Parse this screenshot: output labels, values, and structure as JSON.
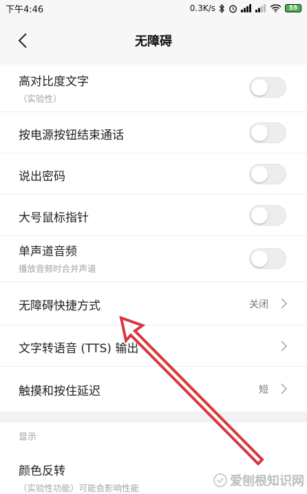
{
  "status_bar": {
    "time": "下午4:46",
    "net_speed": "0.3K/s",
    "battery": "55"
  },
  "header": {
    "title": "无障碍"
  },
  "settings": [
    {
      "title": "高对比度文字",
      "subtitle": "（实验性）",
      "control": "toggle",
      "on": false
    },
    {
      "title": "按电源按钮结束通话",
      "control": "toggle",
      "on": false
    },
    {
      "title": "说出密码",
      "control": "toggle",
      "on": false
    },
    {
      "title": "大号鼠标指针",
      "control": "toggle",
      "on": false
    },
    {
      "title": "单声道音频",
      "subtitle": "播放音频时合并声道",
      "control": "toggle",
      "on": false
    },
    {
      "title": "无障碍快捷方式",
      "value": "关闭",
      "control": "chevron"
    },
    {
      "title": "文字转语音 (TTS) 输出",
      "control": "chevron"
    },
    {
      "title": "触摸和按住延迟",
      "value": "短",
      "control": "chevron"
    }
  ],
  "display_section": {
    "header": "显示",
    "item": {
      "title": "颜色反转",
      "subtitle": "（实验性功能）可能会影响性能"
    }
  },
  "watermark": "爱刨根知识网",
  "annotation_color": "#d9363e"
}
